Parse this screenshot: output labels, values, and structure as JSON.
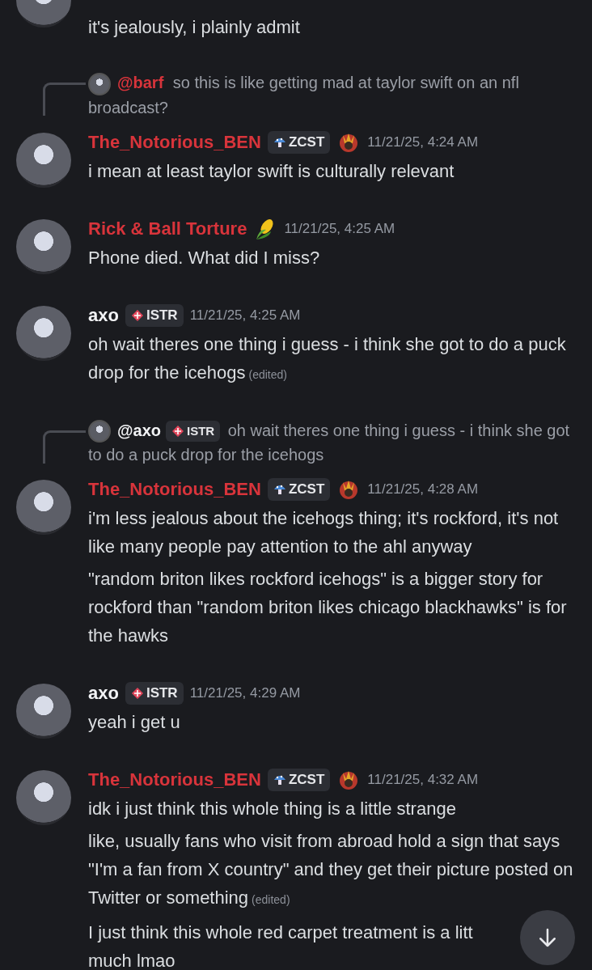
{
  "messages": [
    {
      "paragraphs": [
        {
          "text": "it's jealously, i plainly admit"
        }
      ]
    },
    {
      "reply": {
        "author": "@barf",
        "color": "#d8343b",
        "text": "so this is like getting mad at taylor swift on an nfl broadcast?"
      },
      "author": "The_Notorious_BEN",
      "color": "#d8343b",
      "badge": {
        "label": "ZCST",
        "kind": "mushroom"
      },
      "emblem": {
        "kind": "crest"
      },
      "timestamp": "11/21/25, 4:24 AM",
      "paragraphs": [
        {
          "text": "i mean at least taylor swift is culturally relevant"
        }
      ]
    },
    {
      "author": "Rick & Ball Torture",
      "color": "#d8343b",
      "emblem": {
        "kind": "corn"
      },
      "timestamp": "11/21/25, 4:25 AM",
      "paragraphs": [
        {
          "text": "Phone died.  What did I miss?"
        }
      ]
    },
    {
      "author": "axo",
      "color": "#f2f3f5",
      "badge": {
        "label": "ISTR",
        "kind": "diamond"
      },
      "timestamp": "11/21/25, 4:25 AM",
      "paragraphs": [
        {
          "text": "oh wait theres one thing i guess - i think she got to do a puck drop for the icehogs",
          "edited": "(edited)"
        }
      ]
    },
    {
      "reply": {
        "author": "@axo",
        "color": "#f2f3f5",
        "badge": {
          "label": "ISTR",
          "kind": "diamond"
        },
        "text": "oh wait theres one thing i guess - i think she got to do a puck drop for the icehogs"
      },
      "author": "The_Notorious_BEN",
      "color": "#d8343b",
      "badge": {
        "label": "ZCST",
        "kind": "mushroom"
      },
      "emblem": {
        "kind": "crest"
      },
      "timestamp": "11/21/25, 4:28 AM",
      "paragraphs": [
        {
          "text": "i'm less jealous about the icehogs thing; it's rockford, it's not like many people pay attention to the ahl anyway"
        },
        {
          "text": "\"random briton likes rockford icehogs\" is a bigger story for rockford than \"random briton likes chicago blackhawks\" is for the hawks"
        }
      ]
    },
    {
      "author": "axo",
      "color": "#f2f3f5",
      "badge": {
        "label": "ISTR",
        "kind": "diamond"
      },
      "timestamp": "11/21/25, 4:29 AM",
      "paragraphs": [
        {
          "text": "yeah i get u"
        }
      ]
    },
    {
      "author": "The_Notorious_BEN",
      "color": "#d8343b",
      "badge": {
        "label": "ZCST",
        "kind": "mushroom"
      },
      "emblem": {
        "kind": "crest"
      },
      "timestamp": "11/21/25, 4:32 AM",
      "paragraphs": [
        {
          "text": "idk i just think this whole thing is a little strange"
        },
        {
          "text": "like, usually fans who visit from abroad hold a sign that says \"I'm a fan from X country\" and they get their picture posted on Twitter or something",
          "edited": "(edited)"
        },
        {
          "text": "I just think this whole red carpet treatment is a litt\nmuch lmao"
        }
      ]
    }
  ]
}
